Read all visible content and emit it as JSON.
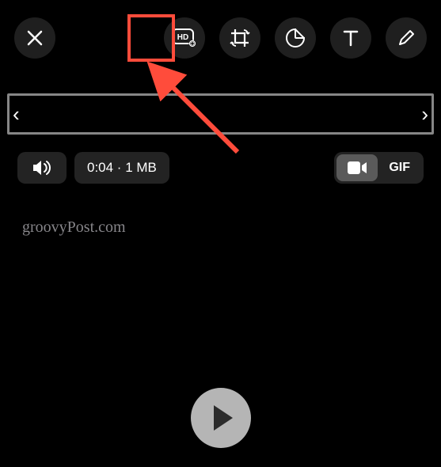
{
  "toolbar": {
    "close": "close",
    "hd": "hd-quality",
    "crop": "crop-rotate",
    "sticker": "sticker",
    "text": "text",
    "draw": "draw"
  },
  "trim": {
    "left_handle": "‹",
    "right_handle": "›"
  },
  "info": {
    "duration_size": "0:04 · 1 MB"
  },
  "format": {
    "gif_label": "GIF"
  },
  "watermark": "groovyPost.com",
  "highlight": {
    "target": "hd-button"
  }
}
